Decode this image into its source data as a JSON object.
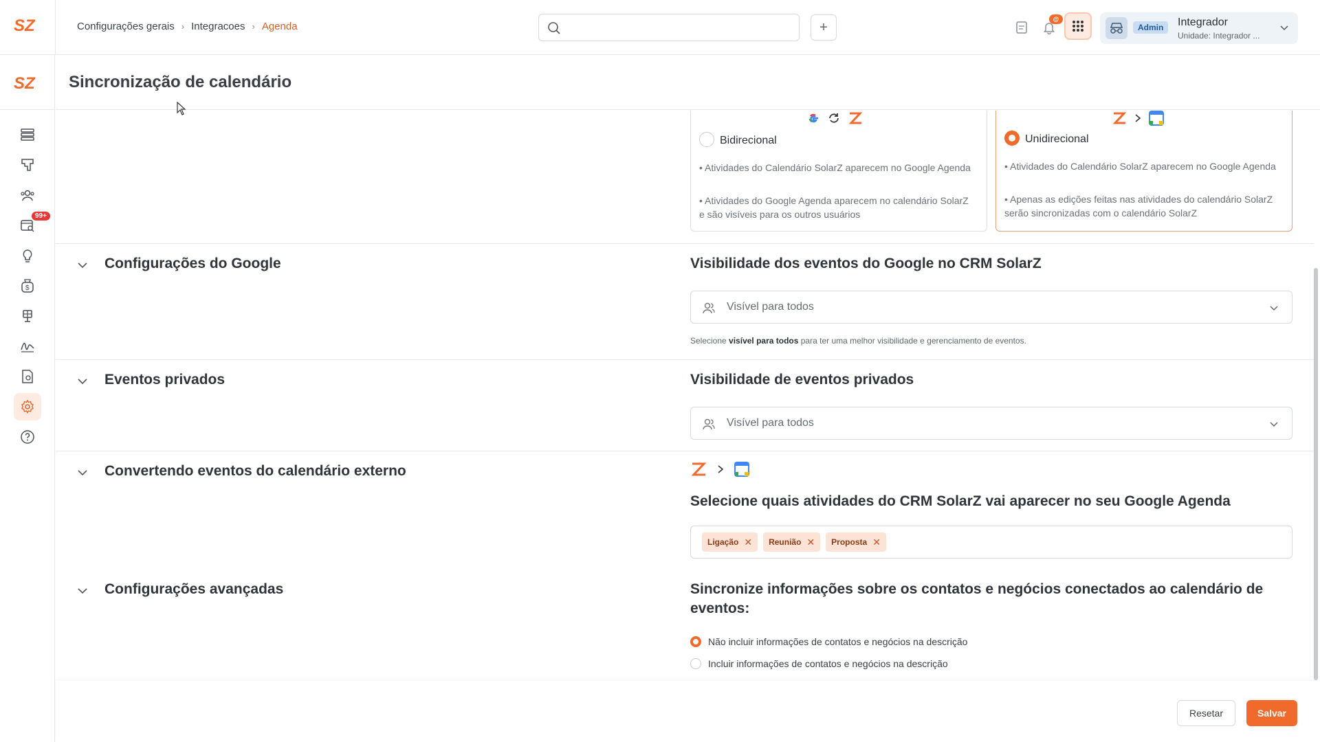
{
  "brand": {
    "logo_text": "SZ",
    "accent_color": "#f06a2b"
  },
  "breadcrumb": [
    "Configurações gerais",
    "Integracoes",
    "Agenda"
  ],
  "search": {
    "placeholder": ""
  },
  "topbar": {
    "notification_count": "@",
    "add_label": "+"
  },
  "user": {
    "role_badge": "Admin",
    "name": "Integrador",
    "unit": "Unidade: Integrador ..."
  },
  "sidebar": {
    "items": [
      {
        "icon": "list-icon"
      },
      {
        "icon": "board-icon"
      },
      {
        "icon": "users-icon"
      },
      {
        "icon": "calendar-search-icon",
        "badge": "99+"
      },
      {
        "icon": "lightbulb-icon"
      },
      {
        "icon": "money-bag-icon"
      },
      {
        "icon": "solar-panel-icon"
      },
      {
        "icon": "signature-icon"
      },
      {
        "icon": "document-settings-icon"
      },
      {
        "icon": "gear-icon",
        "active": true
      },
      {
        "icon": "help-icon"
      }
    ]
  },
  "page": {
    "title": "Sincronização de calendário"
  },
  "sync_options": [
    {
      "label": "Bidirecional",
      "selected": false,
      "bullets": [
        "• Atividades do Calendário SolarZ aparecem no Google Agenda",
        "• Atividades do Google Agenda aparecem no calendário SolarZ e são visíveis para os outros usuários"
      ]
    },
    {
      "label": "Unidirecional",
      "selected": true,
      "bullets": [
        "• Atividades do Calendário SolarZ aparecem no Google Agenda",
        "• Apenas as edições feitas nas atividades do calendário SolarZ serão sincronizadas com o calendário SolarZ"
      ]
    }
  ],
  "google_settings": {
    "section_title": "Configurações do Google",
    "field_title": "Visibilidade dos eventos do Google no CRM SolarZ",
    "select_value": "Visível para todos",
    "helper_prefix": "Selecione ",
    "helper_bold": "visível para todos",
    "helper_suffix": " para ter uma melhor visibilidade e gerenciamento de eventos."
  },
  "private_events": {
    "section_title": "Eventos privados",
    "field_title": "Visibilidade de eventos privados",
    "select_value": "Visível para todos"
  },
  "external_conversion": {
    "section_title": "Convertendo eventos do calendário externo",
    "field_title": "Selecione quais atividades do CRM SolarZ vai aparecer no seu Google Agenda",
    "tags": [
      "Ligação",
      "Reunião",
      "Proposta"
    ]
  },
  "advanced": {
    "section_title": "Configurações avançadas",
    "field_title": "Sincronize informações sobre os contatos e negócios conectados ao calendário de eventos:",
    "options": [
      {
        "label": "Não incluir informações de contatos e negócios na descrição",
        "selected": true
      },
      {
        "label": "Incluir informações de contatos e negócios na descrição",
        "selected": false
      }
    ]
  },
  "footer": {
    "reset_label": "Resetar",
    "save_label": "Salvar"
  }
}
